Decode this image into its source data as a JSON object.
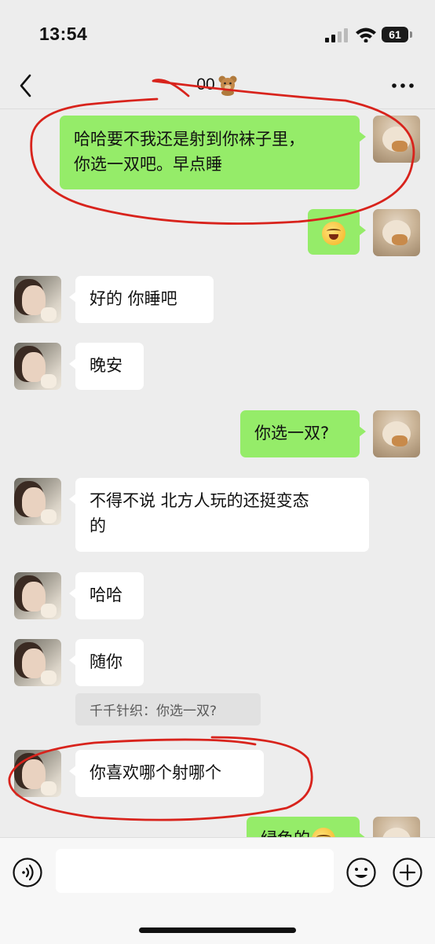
{
  "status_bar": {
    "time": "13:54",
    "battery": "61"
  },
  "nav": {
    "title": "00"
  },
  "messages": [
    {
      "side": "right",
      "kind": "text",
      "text_line1": "哈哈要不我还是射到你袜子里，",
      "text_line2": "你选一双吧。早点睡"
    },
    {
      "side": "right",
      "kind": "emoji",
      "emoji": "crying-laughing-face"
    },
    {
      "side": "left",
      "kind": "text",
      "text": "好的 你睡吧"
    },
    {
      "side": "left",
      "kind": "text",
      "text": "晚安"
    },
    {
      "side": "right",
      "kind": "text",
      "text": "你选一双?"
    },
    {
      "side": "left",
      "kind": "text",
      "text_line1": "不得不说 北方人玩的还挺变态",
      "text_line2": "的"
    },
    {
      "side": "left",
      "kind": "text",
      "text": "哈哈"
    },
    {
      "side": "left",
      "kind": "text",
      "text": "随你"
    },
    {
      "side": "left",
      "kind": "quote",
      "text": "千千针织：你选一双?"
    },
    {
      "side": "left",
      "kind": "text",
      "text": "你喜欢哪个射哪个"
    },
    {
      "side": "right",
      "kind": "text",
      "text": "绿色的"
    }
  ],
  "input_bar": {
    "icons": [
      "voice-icon",
      "emoji-icon",
      "plus-icon"
    ]
  },
  "colors": {
    "sent_bubble": "#95ec69",
    "received_bubble": "#ffffff",
    "background": "#ededed",
    "annotation": "#d8231c"
  }
}
